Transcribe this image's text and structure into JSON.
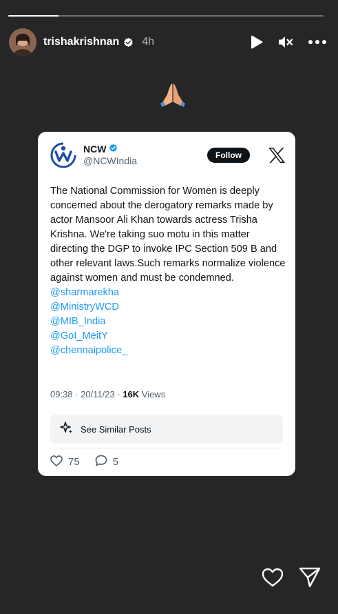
{
  "story": {
    "progress": 0.16,
    "username": "trishakrishnan",
    "timestamp": "4h",
    "header_icons": [
      "play-icon",
      "muted-speaker-icon",
      "more-icon"
    ],
    "reaction_emoji": "folded-hands-icon",
    "bottom_icons": [
      "heart-icon",
      "send-icon"
    ]
  },
  "tweet": {
    "account_name": "NCW",
    "account_handle": "@NCWIndia",
    "follow_label": "Follow",
    "body": "The National Commission for Women is deeply concerned about the derogatory remarks made by actor Mansoor Ali Khan towards actress Trisha Krishna. We're taking suo motu in this matter directing the DGP to invoke IPC Section 509 B and other relevant laws.Such remarks normalize violence against women and must be condemned.",
    "mentions": [
      "@sharmarekha",
      "@MinistryWCD",
      "@MIB_India",
      "@GoI_MeitY",
      "@chennaipolice_"
    ],
    "time": "09:38 · 20/11/23 · ",
    "views_count": "16K",
    "views_label": " Views",
    "similar_label": "See Similar Posts",
    "likes": "75",
    "replies": "5"
  },
  "colors": {
    "background": "#262626",
    "link": "#1d9bf0",
    "verified": "#1d9bf0",
    "ncw_logo": "#1d4fa0"
  }
}
